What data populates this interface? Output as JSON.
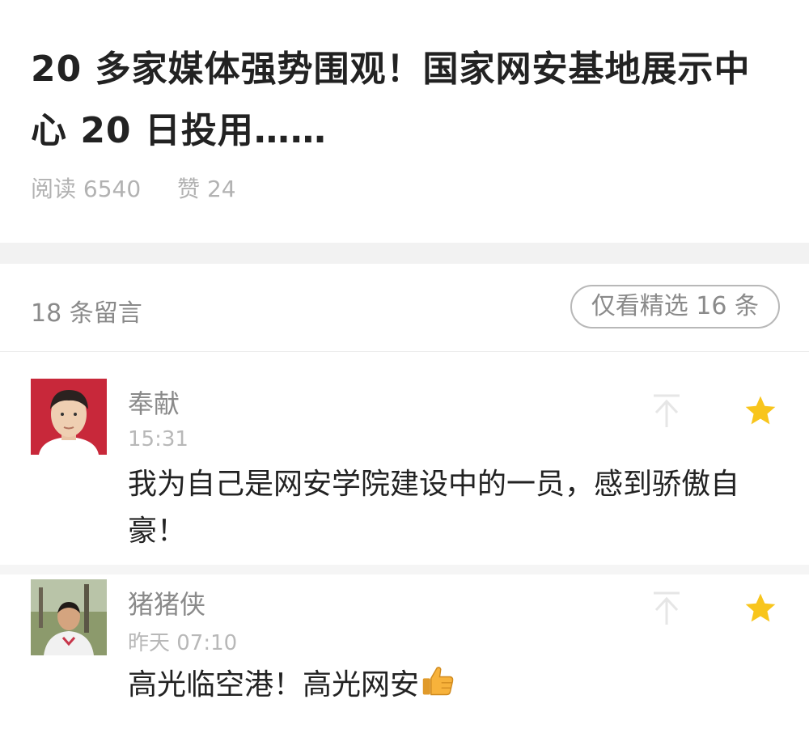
{
  "article": {
    "title": "20 多家媒体强势围观！国家网安基地展示中心 20 日投用……",
    "reads": "阅读 6540",
    "likes": "赞 24"
  },
  "comments_header": {
    "count": "18 条留言",
    "filter_label": "仅看精选 16 条"
  },
  "comments": [
    {
      "author": "奉献",
      "time": "15:31",
      "text": "我为自己是网安学院建设中的一员，感到骄傲自豪！"
    },
    {
      "author": "猪猪侠",
      "time": "昨天 07:10",
      "text": "高光临空港！高光网安"
    }
  ],
  "colors": {
    "star": "#f8c51c",
    "muted": "#8a8a8a",
    "divider": "#f2f2f2"
  },
  "icons": {
    "pin": "pin-top-icon",
    "star": "star-icon",
    "thumb": "thumbs-up-emoji"
  }
}
